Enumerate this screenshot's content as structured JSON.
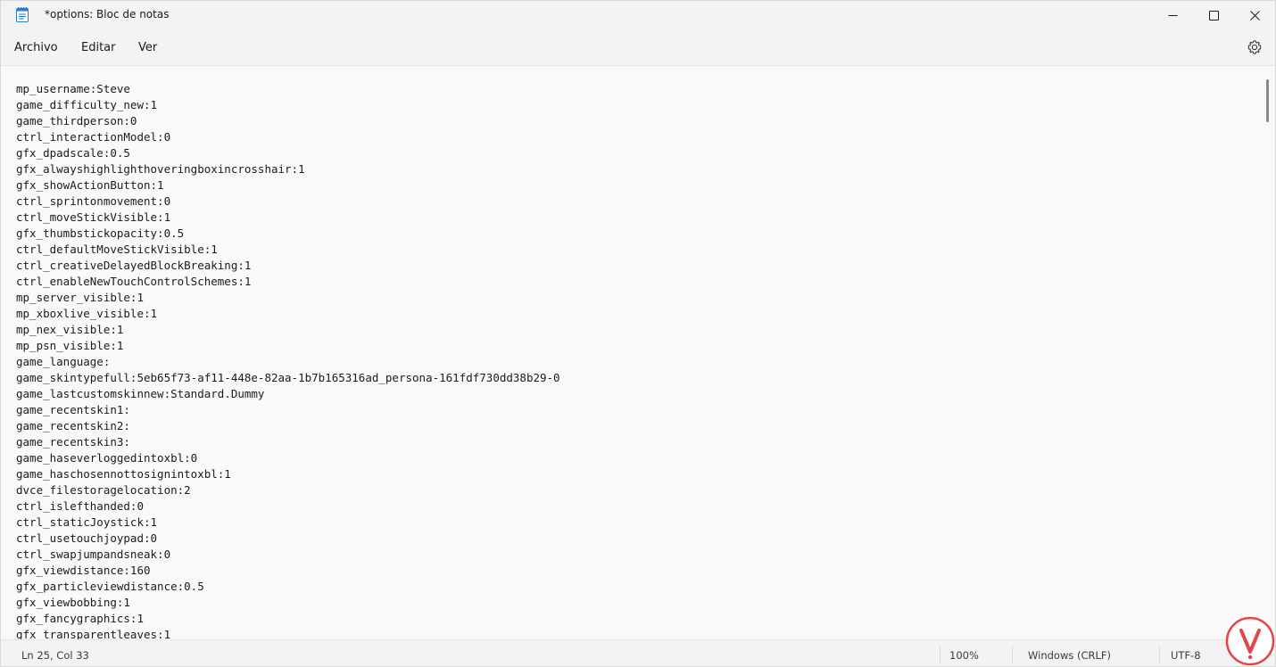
{
  "window": {
    "title": "*options: Bloc de notas"
  },
  "menu": {
    "items": [
      {
        "label": "Archivo"
      },
      {
        "label": "Editar"
      },
      {
        "label": "Ver"
      }
    ]
  },
  "icons": {
    "app": "notepad-icon",
    "minimize": "minimize-icon",
    "maximize": "maximize-icon",
    "close": "close-icon",
    "settings": "gear-icon",
    "watermark": "logo-icon"
  },
  "editor": {
    "lines": [
      "mp_username:Steve",
      "game_difficulty_new:1",
      "game_thirdperson:0",
      "ctrl_interactionModel:0",
      "gfx_dpadscale:0.5",
      "gfx_alwayshighlighthoveringboxincrosshair:1",
      "gfx_showActionButton:1",
      "ctrl_sprintonmovement:0",
      "ctrl_moveStickVisible:1",
      "gfx_thumbstickopacity:0.5",
      "ctrl_defaultMoveStickVisible:1",
      "ctrl_creativeDelayedBlockBreaking:1",
      "ctrl_enableNewTouchControlSchemes:1",
      "mp_server_visible:1",
      "mp_xboxlive_visible:1",
      "mp_nex_visible:1",
      "mp_psn_visible:1",
      "game_language:",
      "game_skintypefull:5eb65f73-af11-448e-82aa-1b7b165316ad_persona-161fdf730dd38b29-0",
      "game_lastcustomskinnew:Standard.Dummy",
      "game_recentskin1:",
      "game_recentskin2:",
      "game_recentskin3:",
      "game_haseverloggedintoxbl:0",
      "game_haschosennottosignintoxbl:1",
      "dvce_filestoragelocation:2",
      "ctrl_islefthanded:0",
      "ctrl_staticJoystick:1",
      "ctrl_usetouchjoypad:0",
      "ctrl_swapjumpandsneak:0",
      "gfx_viewdistance:160",
      "gfx_particleviewdistance:0.5",
      "gfx_viewbobbing:1",
      "gfx_fancygraphics:1",
      "gfx_transparentleaves:1"
    ]
  },
  "status": {
    "position": "Ln 25, Col 33",
    "zoom": "100%",
    "line_ending": "Windows (CRLF)",
    "encoding": "UTF-8"
  },
  "colors": {
    "chrome": "#f3f3f3",
    "editor_bg": "#f9f9f9",
    "text": "#1b1b1b",
    "watermark": "#e0262b"
  }
}
